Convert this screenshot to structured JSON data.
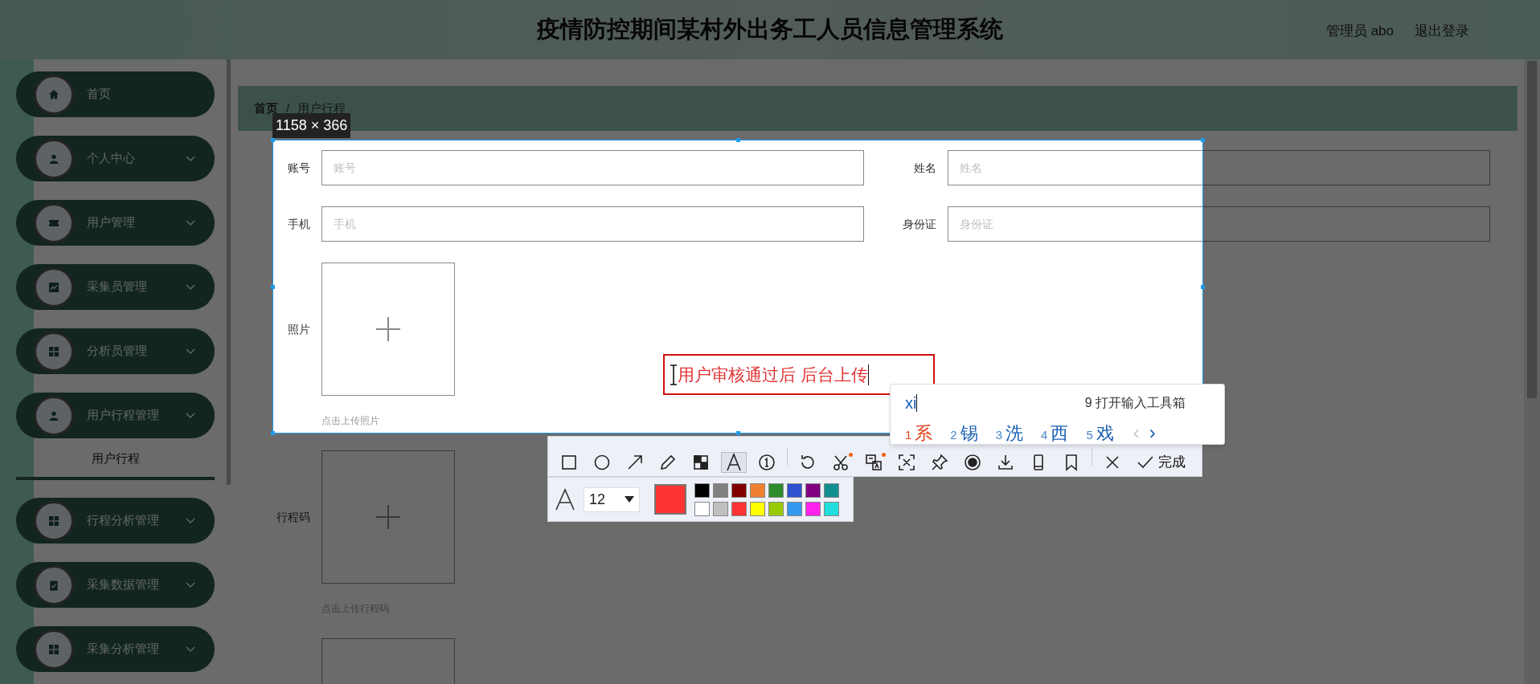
{
  "header": {
    "title": "疫情防控期间某村外出务工人员信息管理系统",
    "user": "管理员 abo",
    "logout": "退出登录"
  },
  "sidebar": {
    "items": [
      {
        "label": "首页",
        "kind": "link"
      },
      {
        "label": "个人中心",
        "kind": "menu"
      },
      {
        "label": "用户管理",
        "kind": "menu"
      },
      {
        "label": "采集员管理",
        "kind": "menu"
      },
      {
        "label": "分析员管理",
        "kind": "menu"
      },
      {
        "label": "用户行程管理",
        "kind": "menu",
        "children": [
          {
            "label": "用户行程",
            "selected": true
          }
        ]
      },
      {
        "label": "行程分析管理",
        "kind": "menu"
      },
      {
        "label": "采集数据管理",
        "kind": "menu"
      },
      {
        "label": "采集分析管理",
        "kind": "menu"
      }
    ]
  },
  "breadcrumb": {
    "items": [
      "首页",
      "用户行程"
    ],
    "separator": "/"
  },
  "form": {
    "rows": [
      [
        {
          "label": "账号",
          "placeholder": "账号"
        },
        {
          "label": "姓名",
          "placeholder": "姓名"
        }
      ],
      [
        {
          "label": "手机",
          "placeholder": "手机"
        },
        {
          "label": "身份证",
          "placeholder": "身份证"
        }
      ]
    ],
    "uploads": [
      {
        "kind": "upload",
        "label": "照片",
        "hint": "点击上传照片"
      },
      {
        "kind": "upload",
        "label": "行程码",
        "hint": "点击上传行程码"
      },
      {
        "kind": "upload"
      }
    ]
  },
  "capture": {
    "size": "1158 × 366",
    "annotation": "用户审核通过后 后台上传",
    "tools": [
      {
        "kind": "rect",
        "selected": false
      },
      {
        "kind": "ellipse",
        "selected": false
      },
      {
        "kind": "arrow",
        "selected": false
      },
      {
        "kind": "pencil",
        "selected": false
      },
      {
        "kind": "mosaic",
        "selected": false
      },
      {
        "kind": "text",
        "selected": true
      },
      {
        "kind": "number",
        "selected": false
      },
      {
        "kind": "undo",
        "selected": false
      },
      {
        "kind": "cut",
        "selected": false,
        "badge": true
      },
      {
        "kind": "translate",
        "selected": false,
        "badge": true
      },
      {
        "kind": "ocr",
        "selected": false
      },
      {
        "kind": "pin",
        "selected": false
      },
      {
        "kind": "record",
        "selected": false
      },
      {
        "kind": "save",
        "selected": false
      },
      {
        "kind": "phone",
        "selected": false
      },
      {
        "kind": "bookmark",
        "selected": false
      },
      {
        "kind": "close",
        "selected": false
      },
      {
        "kind": "done",
        "selected": false,
        "label": "完成"
      }
    ],
    "font_size": "12",
    "palette": [
      {
        "color": "#000000"
      },
      {
        "color": "#808080"
      },
      {
        "color": "#800000"
      },
      {
        "color": "#f08030"
      },
      {
        "color": "#2e8b2e"
      },
      {
        "color": "#3050d0"
      },
      {
        "color": "#800080"
      },
      {
        "color": "#109090"
      },
      {
        "color": "#ffffff"
      },
      {
        "color": "#c0c0c0"
      },
      {
        "color": "#ff3333"
      },
      {
        "color": "#ffff00"
      },
      {
        "color": "#99cc00"
      },
      {
        "color": "#3399ee"
      },
      {
        "color": "#ff22ee"
      },
      {
        "color": "#22dddd"
      }
    ]
  },
  "ime": {
    "input": "xi",
    "toolbox": "9 打开输入工具箱",
    "candidates": [
      {
        "index": "1",
        "text": "系",
        "selected": true
      },
      {
        "index": "2",
        "text": "锡",
        "selected": false
      },
      {
        "index": "3",
        "text": "洗",
        "selected": false
      },
      {
        "index": "4",
        "text": "西",
        "selected": false
      },
      {
        "index": "5",
        "text": "戏",
        "selected": false
      }
    ],
    "prev": "‹",
    "next": "›"
  }
}
